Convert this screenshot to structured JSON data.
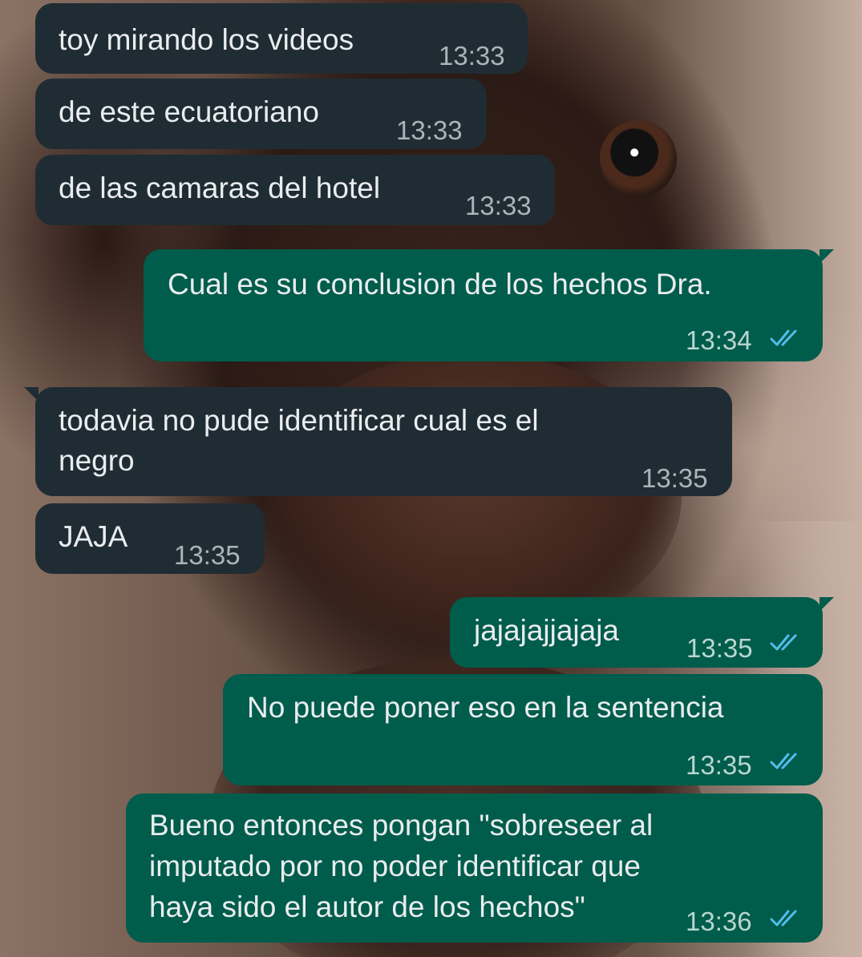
{
  "messages": [
    {
      "text": "toy mirando los videos",
      "time": "13:33",
      "direction": "incoming"
    },
    {
      "text": "de este ecuatoriano",
      "time": "13:33",
      "direction": "incoming"
    },
    {
      "text": "de las camaras del hotel",
      "time": "13:33",
      "direction": "incoming"
    },
    {
      "text": "Cual es su conclusion de los hechos Dra.",
      "time": "13:34",
      "direction": "outgoing",
      "status": "read"
    },
    {
      "lines": [
        "todavia no pude identificar cual es el",
        "negro"
      ],
      "time": "13:35",
      "direction": "incoming"
    },
    {
      "text": "JAJA",
      "time": "13:35",
      "direction": "incoming"
    },
    {
      "text": "jajajajjajaja",
      "time": "13:35",
      "direction": "outgoing",
      "status": "read"
    },
    {
      "text": "No puede poner eso en la sentencia",
      "time": "13:35",
      "direction": "outgoing",
      "status": "read"
    },
    {
      "lines": [
        "Bueno entonces pongan \"sobreseer al",
        "imputado por no poder identificar que",
        "haya sido el autor de los hechos\""
      ],
      "time": "13:36",
      "direction": "outgoing",
      "status": "read"
    }
  ],
  "colors": {
    "incoming_bubble": "#202c33",
    "outgoing_bubble": "#005c4b",
    "text": "#e9edef",
    "read_ticks": "#53bdeb"
  },
  "icons": {
    "read_receipt": "double-check-icon"
  }
}
